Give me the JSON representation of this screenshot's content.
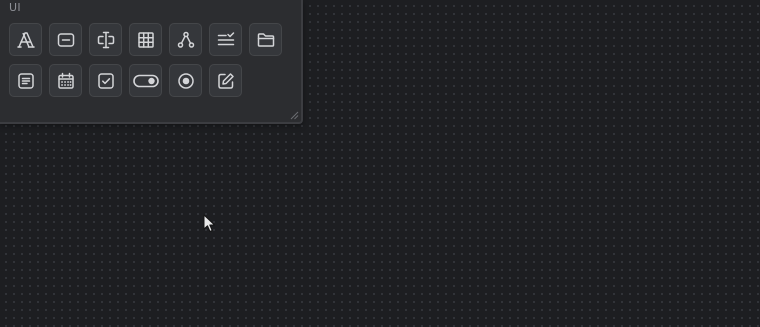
{
  "panel": {
    "title": "UI",
    "tools": [
      {
        "name": "text-tool",
        "icon": "letter-a-icon"
      },
      {
        "name": "input-tool",
        "icon": "input-field-icon"
      },
      {
        "name": "label-tool",
        "icon": "label-cursor-icon"
      },
      {
        "name": "table-tool",
        "icon": "table-icon"
      },
      {
        "name": "tree-tool",
        "icon": "hierarchy-icon"
      },
      {
        "name": "list-tool",
        "icon": "list-check-icon"
      },
      {
        "name": "folder-tool",
        "icon": "folder-icon"
      },
      {
        "name": "textarea-tool",
        "icon": "text-lines-icon"
      },
      {
        "name": "date-tool",
        "icon": "calendar-icon"
      },
      {
        "name": "checkbox-tool",
        "icon": "checkbox-icon"
      },
      {
        "name": "toggle-tool",
        "icon": "toggle-icon"
      },
      {
        "name": "radio-tool",
        "icon": "radio-icon"
      },
      {
        "name": "edit-tool",
        "icon": "edit-icon"
      }
    ]
  },
  "colors": {
    "background": "#1d1e21",
    "panel": "#2c2d30",
    "icon": "#d4d5d8"
  }
}
